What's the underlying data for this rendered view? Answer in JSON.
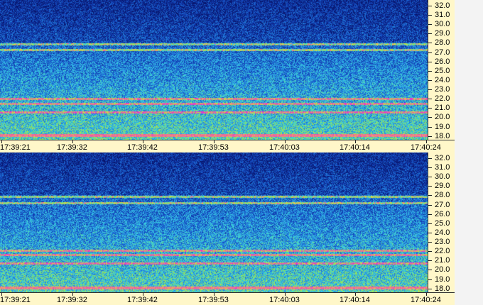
{
  "y_ticks": [
    "32.0",
    "31.0",
    "30.0",
    "29.0",
    "28.0",
    "27.0",
    "26.0",
    "25.0",
    "24.0",
    "23.0",
    "22.0",
    "21.0",
    "20.0",
    "19.0",
    "18.0"
  ],
  "x_ticks": [
    "17:39:21",
    "17:39:32",
    "17:39:42",
    "17:39:53",
    "17:40:03",
    "17:40:14",
    "17:40:24"
  ],
  "colors": {
    "axis_bg": "#fff7c9",
    "deep_blue": "#0a2a8a",
    "cyan": "#35c8e0",
    "green": "#8ee04a",
    "magenta": "#e040c0"
  },
  "chart_data": [
    {
      "type": "heatmap",
      "ylim": [
        17.6,
        32.6
      ],
      "y_ticks": [
        32,
        31,
        30,
        29,
        28,
        27,
        26,
        25,
        24,
        23,
        22,
        21,
        20,
        19,
        18
      ],
      "x_ticks": [
        "17:39:21",
        "17:39:32",
        "17:39:42",
        "17:39:53",
        "17:40:03",
        "17:40:14",
        "17:40:24"
      ],
      "bands": [
        27.9,
        27.3,
        22.0,
        21.5,
        20.6,
        18.1
      ],
      "hot_band": 18.1
    },
    {
      "type": "heatmap",
      "ylim": [
        17.6,
        32.6
      ],
      "y_ticks": [
        32,
        31,
        30,
        29,
        28,
        27,
        26,
        25,
        24,
        23,
        22,
        21,
        20,
        19,
        18
      ],
      "x_ticks": [
        "17:39:21",
        "17:39:32",
        "17:39:42",
        "17:39:53",
        "17:40:03",
        "17:40:14",
        "17:40:24"
      ],
      "bands": [
        27.9,
        27.2,
        22.1,
        21.6,
        20.7,
        18.1
      ],
      "hot_band": 18.1
    }
  ]
}
